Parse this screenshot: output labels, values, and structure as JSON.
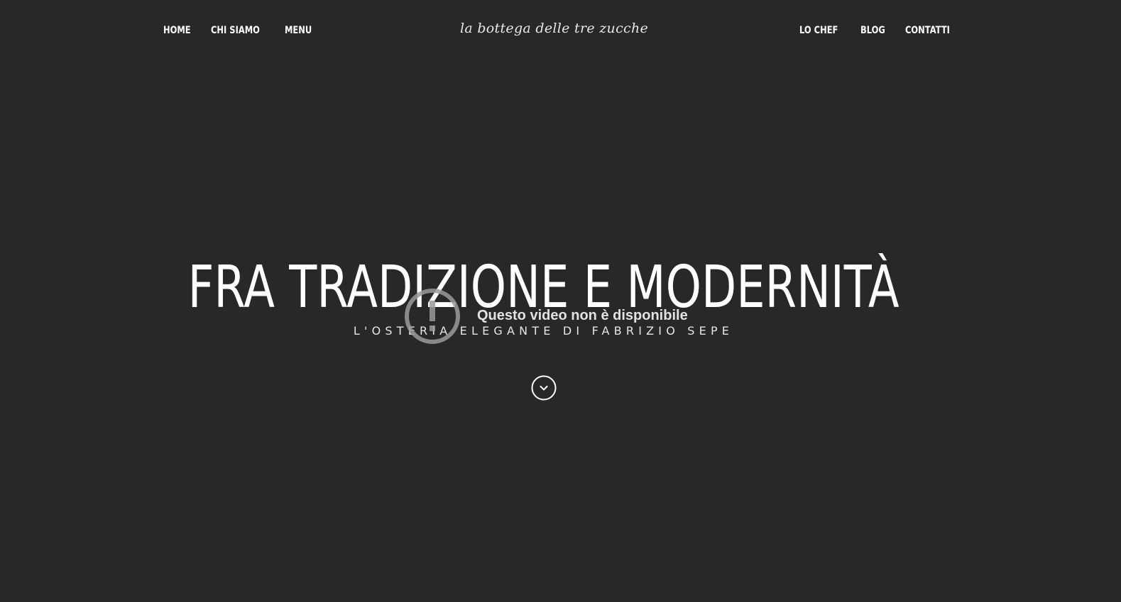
{
  "nav_left": [
    {
      "label": "HOME"
    },
    {
      "label": "CHI SIAMO"
    },
    {
      "label": "MENU"
    }
  ],
  "logo": {
    "text": "la bottega delle tre zucche"
  },
  "nav_right": [
    {
      "label": "LO CHEF"
    },
    {
      "label": "BLOG"
    },
    {
      "label": "CONTATTI"
    }
  ],
  "hero": {
    "title": "FRA TRADIZIONE E MODERNITÀ",
    "subtitle": "L'OSTERIA ELEGANTE DI FABRIZIO SEPE"
  },
  "video": {
    "message": "Questo video non è disponibile",
    "icon": "alert-circle-icon"
  },
  "scroll": {
    "icon": "chevron-down-circle-icon"
  },
  "colors": {
    "background": "#282828",
    "text": "#ffffff"
  }
}
